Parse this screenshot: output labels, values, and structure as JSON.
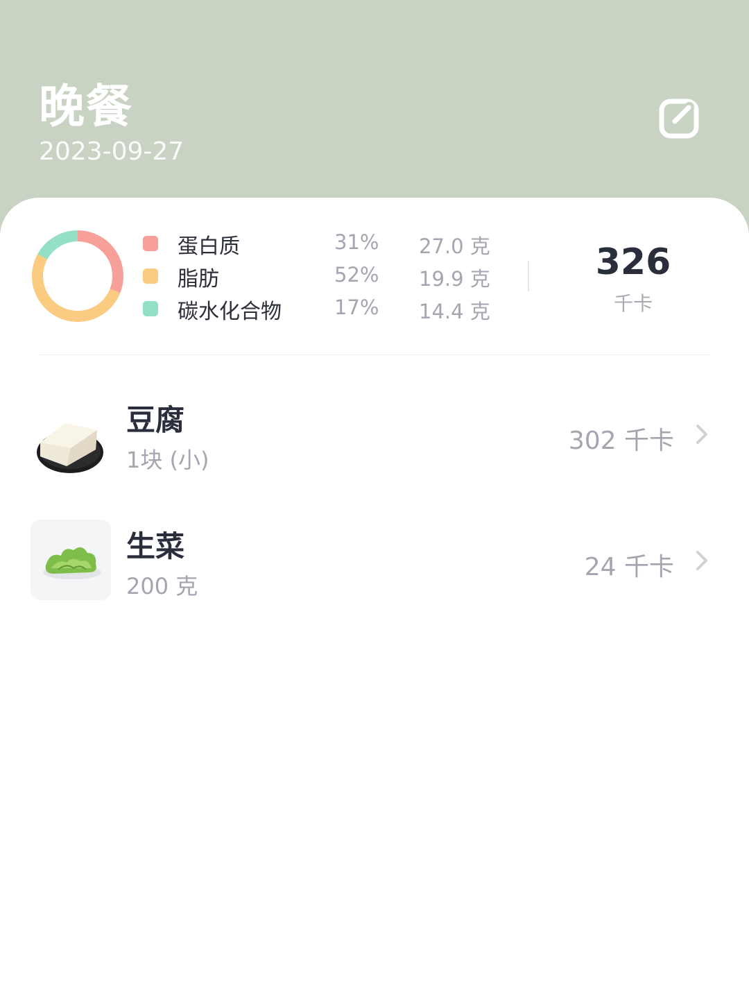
{
  "header": {
    "title": "晚餐",
    "date": "2023-09-27",
    "edit_icon": "edit-icon"
  },
  "summary": {
    "chart_data": {
      "type": "pie",
      "categories": [
        "蛋白质",
        "脂肪",
        "碳水化合物"
      ],
      "values": [
        31,
        52,
        17
      ],
      "colors": [
        "#f7a09a",
        "#fccb82",
        "#93e0c4"
      ]
    },
    "macros": [
      {
        "name": "蛋白质",
        "percent": "31%",
        "grams": "27.0 克",
        "color": "#f7a09a"
      },
      {
        "name": "脂肪",
        "percent": "52%",
        "grams": "19.9 克",
        "color": "#fccb82"
      },
      {
        "name": "碳水化合物",
        "percent": "17%",
        "grams": "14.4 克",
        "color": "#93e0c4"
      }
    ],
    "total_kcal": "326",
    "total_unit": "千卡"
  },
  "foods": [
    {
      "name": "豆腐",
      "amount": "1块 (小)",
      "kcal": "302 千卡",
      "image": "tofu-image"
    },
    {
      "name": "生菜",
      "amount": "200 克",
      "kcal": "24 千卡",
      "image": "lettuce-image"
    }
  ]
}
